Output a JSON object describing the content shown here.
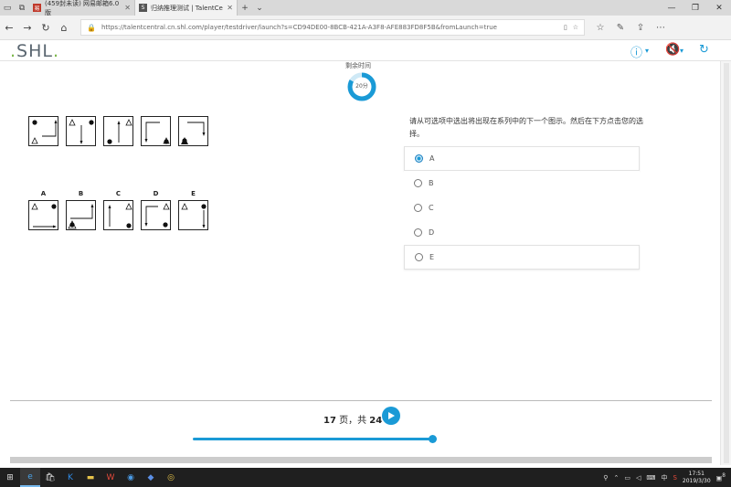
{
  "browser": {
    "tabs": [
      {
        "title": "(459封未读) 网易邮箱6.0版",
        "icon": "mail-icon",
        "active": false
      },
      {
        "title": "归纳推理测试 | TalentCe",
        "icon": "shl-tab-icon",
        "active": true
      }
    ],
    "url": "https://talentcentral.cn.shl.com/player/testdriver/launch?s=CD94DE00-8BCB-421A-A3F8-AFE883FD8F5B&fromLaunch=true"
  },
  "app": {
    "logo": ".SHL."
  },
  "timer": {
    "label": "剩余时间",
    "value": "20分",
    "fraction": 0.83
  },
  "question": {
    "instruction": "请从可选项中选出将出现在系列中的下一个图示。然后在下方点击您的选择。",
    "series_count": 5,
    "option_letters": [
      "A",
      "B",
      "C",
      "D",
      "E"
    ],
    "answers": [
      {
        "label": "A",
        "selected": true
      },
      {
        "label": "B",
        "selected": false
      },
      {
        "label": "C",
        "selected": false
      },
      {
        "label": "D",
        "selected": false
      },
      {
        "label": "E",
        "selected": false
      }
    ]
  },
  "pager": {
    "current": "17",
    "sep": " 页，共 ",
    "total": "24",
    "progress": 0.99
  },
  "taskbar": {
    "ime": "中",
    "time": "17:51",
    "date": "2019/3/30",
    "notifications": "8"
  },
  "colors": {
    "accent": "#1a9ad6",
    "logo_dot": "#7ab648"
  }
}
